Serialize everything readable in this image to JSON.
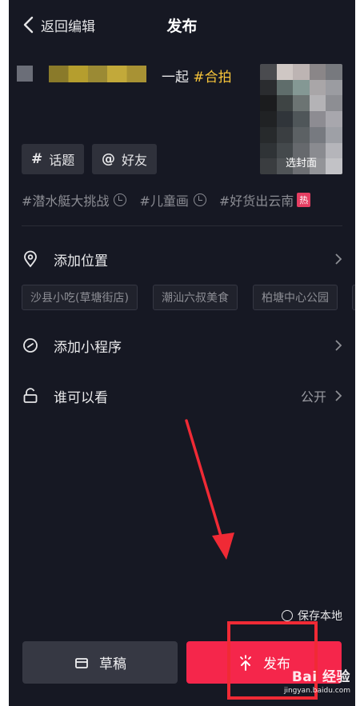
{
  "header": {
    "back_label": "返回编辑",
    "title": "发布"
  },
  "caption": {
    "text": "一起",
    "hashtag": "#合拍"
  },
  "cover": {
    "label": "选封面"
  },
  "tools": {
    "topic_symbol": "#",
    "topic_label": "话题",
    "friend_symbol": "@",
    "friend_label": "好友"
  },
  "hot_topics": [
    {
      "label": "#潜水艇大挑战"
    },
    {
      "label": "#儿童画"
    },
    {
      "label": "#好货出云南",
      "badge": "热"
    }
  ],
  "location": {
    "label": "添加位置",
    "suggestions": [
      "沙县小吃(草塘街店)",
      "潮汕六叔美食",
      "柏塘中心公园"
    ]
  },
  "mini_program": {
    "label": "添加小程序"
  },
  "visibility": {
    "label": "谁可以看",
    "value": "公开"
  },
  "save_local": {
    "label": "保存本地"
  },
  "bottom": {
    "draft_label": "草稿",
    "publish_label": "发布"
  },
  "watermark": {
    "brand": "Bai 经验",
    "site": "jingyan.baidu.com"
  },
  "colors": {
    "background": "#161823",
    "accent": "#f5264b",
    "hashtag": "#f8c53a",
    "annotation": "#f02a35"
  }
}
